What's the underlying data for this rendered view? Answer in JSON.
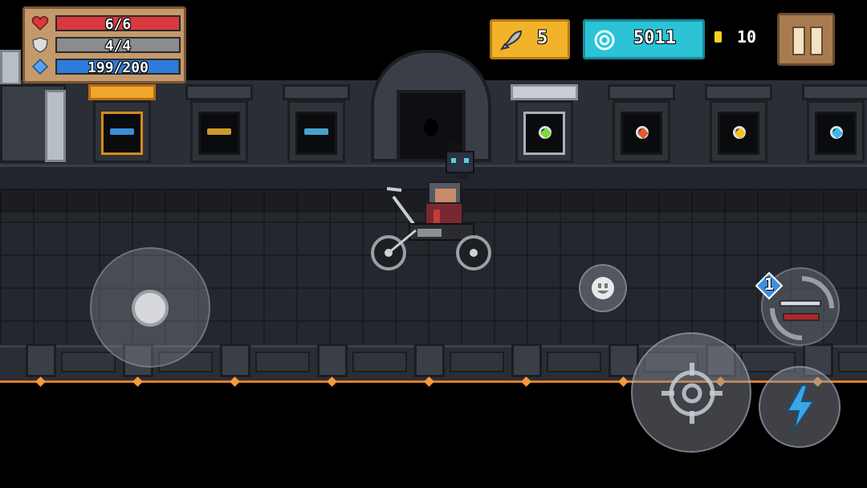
{
  "hud": {
    "health": {
      "icon": "heart-icon",
      "text": "6/6",
      "fraction": 1.0,
      "color": "#d9393d"
    },
    "armor": {
      "icon": "shield-icon",
      "text": "4/4",
      "fraction": 1.0,
      "color": "#8c8c8c"
    },
    "energy": {
      "icon": "diamond-icon",
      "text": "199/200",
      "fraction": 0.995,
      "color": "#2f7bd9"
    },
    "fish": {
      "icon": "fish-icon",
      "value": "5",
      "color": "#f2b22a"
    },
    "gems": {
      "icon": "gem-icon",
      "value": "5011",
      "color": "#2cc3d7"
    },
    "coins": {
      "icon": "coin-icon",
      "value": "10",
      "color": "#f5d21f"
    }
  },
  "controls": {
    "pause": {
      "icon": "pause-icon"
    },
    "joystick": {
      "icon": "joystick-icon"
    },
    "emote": {
      "icon": "smiley-icon"
    },
    "attack": {
      "icon": "crosshair-icon"
    },
    "skill": {
      "icon": "lightning-icon",
      "color": "#39a6e6"
    },
    "weapon_swap": {
      "icon": "weapon-swap-icon",
      "count": "1"
    }
  },
  "pedestals": [
    {
      "kind": "weapon",
      "icon": "rifle-icon",
      "frame": "gold",
      "color": "#3a8fd8"
    },
    {
      "kind": "weapon",
      "icon": "rifle-icon",
      "frame": "plain",
      "color": "#c99a2e"
    },
    {
      "kind": "weapon",
      "icon": "rifle-icon",
      "frame": "plain",
      "color": "#4aa0d0"
    },
    {
      "kind": "ring",
      "icon": "ring-icon",
      "frame": "silver",
      "color": "#7ed83a"
    },
    {
      "kind": "ring",
      "icon": "ring-icon",
      "frame": "plain",
      "color": "#e05a2a"
    },
    {
      "kind": "ring",
      "icon": "ring-icon",
      "frame": "plain",
      "color": "#f2c21f"
    },
    {
      "kind": "ring",
      "icon": "ring-icon",
      "frame": "plain",
      "color": "#3ab8e8"
    }
  ],
  "player": {
    "icon": "player-on-motorcycle-icon",
    "pet_icon": "cat-pet-icon"
  }
}
